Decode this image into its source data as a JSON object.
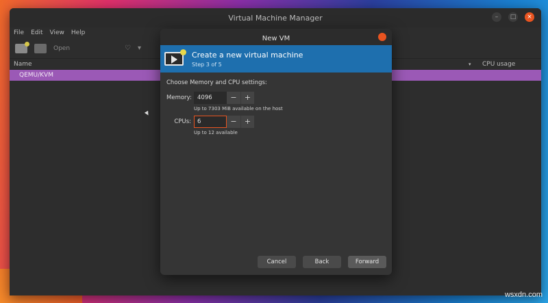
{
  "main_window": {
    "title": "Virtual Machine Manager",
    "window_controls": [
      "–",
      "□",
      "×"
    ],
    "menu": [
      "File",
      "Edit",
      "View",
      "Help"
    ],
    "toolbar": {
      "open_label": "Open",
      "power_icon": "♡",
      "dropdown_icon": "▾"
    },
    "list_header": {
      "name_col": "Name",
      "sort_icon": "▾",
      "cpu_col": "CPU usage"
    },
    "vm_rows": [
      {
        "name": "QEMU/KVM"
      }
    ]
  },
  "dialog": {
    "title": "New VM",
    "banner": {
      "title": "Create a new virtual machine",
      "step": "Step 3 of 5"
    },
    "section_label": "Choose Memory and CPU settings:",
    "memory": {
      "label": "Memory:",
      "value": "4096",
      "hint": "Up to 7303 MiB available on the host"
    },
    "cpus": {
      "label": "CPUs:",
      "value": "6",
      "hint": "Up to 12 available"
    },
    "stepper": {
      "minus": "−",
      "plus": "+"
    },
    "buttons": {
      "cancel": "Cancel",
      "back": "Back",
      "forward": "Forward"
    }
  },
  "watermark": "wsxdn.com",
  "colors": {
    "accent": "#e95420",
    "banner": "#1e6fae",
    "selection": "#9b59b6"
  }
}
